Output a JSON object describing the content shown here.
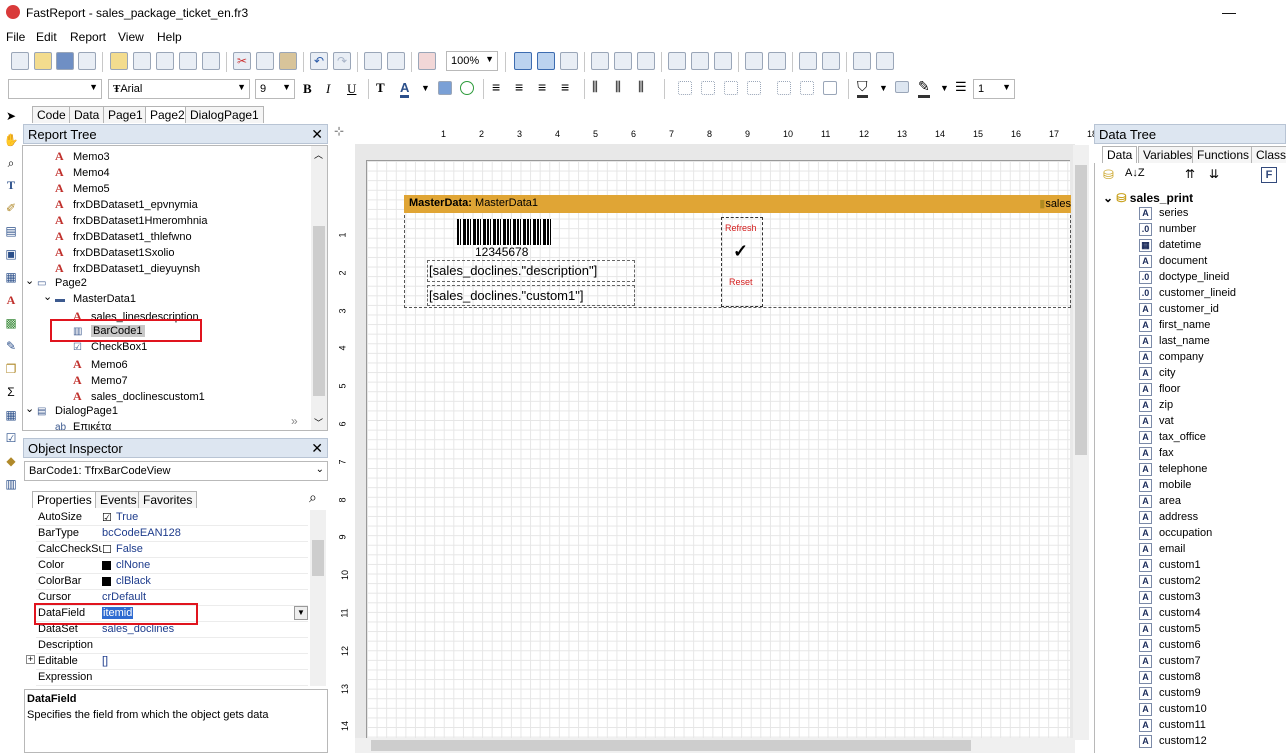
{
  "window": {
    "title": "FastReport - sales_package_ticket_en.fr3",
    "minimize": "—"
  },
  "menu": [
    "File",
    "Edit",
    "Report",
    "View",
    "Help"
  ],
  "toolbar": {
    "zoom": "100%",
    "font_name": "Arial",
    "font_size": "9",
    "line_width": "1"
  },
  "page_tabs": [
    "Code",
    "Data",
    "Page1",
    "Page2",
    "DialogPage1"
  ],
  "report_tree": {
    "title": "Report Tree",
    "nodes": [
      {
        "label": "Memo3",
        "level": 2,
        "icon": "memo-icon"
      },
      {
        "label": "Memo4",
        "level": 2,
        "icon": "memo-icon"
      },
      {
        "label": "Memo5",
        "level": 2,
        "icon": "memo-icon"
      },
      {
        "label": "frxDBDataset1_epvnymia",
        "level": 2,
        "icon": "memo-icon"
      },
      {
        "label": "frxDBDataset1Hmeromhnia",
        "level": 2,
        "icon": "memo-icon"
      },
      {
        "label": "frxDBDataset1_thlefwno",
        "level": 2,
        "icon": "memo-icon"
      },
      {
        "label": "frxDBDataset1Sxolio",
        "level": 2,
        "icon": "memo-icon"
      },
      {
        "label": "frxDBDataset1_dieyuynsh",
        "level": 2,
        "icon": "memo-icon"
      },
      {
        "label": "Page2",
        "level": 1,
        "icon": "page-icon"
      },
      {
        "label": "MasterData1",
        "level": 2,
        "icon": "band-icon"
      },
      {
        "label": "sales_linesdescription",
        "level": 3,
        "icon": "memo-icon"
      },
      {
        "label": "BarCode1",
        "level": 3,
        "icon": "barcode-icon"
      },
      {
        "label": "CheckBox1",
        "level": 3,
        "icon": "checkbox-icon"
      },
      {
        "label": "Memo6",
        "level": 3,
        "icon": "memo-icon"
      },
      {
        "label": "Memo7",
        "level": 3,
        "icon": "memo-icon"
      },
      {
        "label": "sales_doclinescustom1",
        "level": 3,
        "icon": "memo-icon"
      },
      {
        "label": "DialogPage1",
        "level": 1,
        "icon": "dialog-icon"
      },
      {
        "label": "Επικέτα",
        "level": 2,
        "icon": "label-icon"
      }
    ]
  },
  "object_inspector": {
    "title": "Object Inspector",
    "selected": "BarCode1: TfrxBarCodeView",
    "tabs": [
      "Properties",
      "Events",
      "Favorites"
    ],
    "properties": [
      {
        "name": "AutoSize",
        "value": "True"
      },
      {
        "name": "BarType",
        "value": "bcCodeEAN128"
      },
      {
        "name": "CalcCheckSum",
        "value": "False"
      },
      {
        "name": "Color",
        "value": "clNone"
      },
      {
        "name": "ColorBar",
        "value": "clBlack"
      },
      {
        "name": "Cursor",
        "value": "crDefault"
      },
      {
        "name": "DataField",
        "value": "itemid"
      },
      {
        "name": "DataSet",
        "value": "sales_doclines"
      },
      {
        "name": "Description",
        "value": ""
      },
      {
        "name": "Editable",
        "value": "[]"
      },
      {
        "name": "Expression",
        "value": ""
      }
    ],
    "help_title": "DataField",
    "help_text": "Specifies the field from which the object gets data"
  },
  "ruler_h": [
    "1",
    "2",
    "3",
    "4",
    "5",
    "6",
    "7",
    "8",
    "9",
    "10",
    "11",
    "12",
    "13",
    "14",
    "15",
    "16",
    "17",
    "18"
  ],
  "ruler_v": [
    "1",
    "2",
    "3",
    "4",
    "5",
    "6",
    "7",
    "8",
    "9",
    "10",
    "11",
    "12",
    "13",
    "14"
  ],
  "design": {
    "band_label": "MasterData:",
    "band_name": "MasterData1",
    "band_right": "sales",
    "barcode_text": "12345678",
    "memo_description": "[sales_doclines.\"description\"]",
    "memo_custom1": "[sales_doclines.\"custom1\"]",
    "btn_refresh": "Refresh",
    "btn_reset": "Reset",
    "check_mark": "✓"
  },
  "data_tree": {
    "title": "Data Tree",
    "tabs": [
      "Data",
      "Variables",
      "Functions",
      "Class"
    ],
    "root": "sales_print",
    "fields": [
      "series",
      "number",
      "datetime",
      "document",
      "doctype_lineid",
      "customer_lineid",
      "customer_id",
      "first_name",
      "last_name",
      "company",
      "city",
      "floor",
      "zip",
      "vat",
      "tax_office",
      "fax",
      "telephone",
      "mobile",
      "area",
      "address",
      "occupation",
      "email",
      "custom1",
      "custom2",
      "custom3",
      "custom4",
      "custom5",
      "custom6",
      "custom7",
      "custom8",
      "custom9",
      "custom10",
      "custom11",
      "custom12"
    ]
  },
  "colors": {
    "band": "#e0a535",
    "highlight": "#e0141e",
    "panel_header": "#dde6f1"
  }
}
